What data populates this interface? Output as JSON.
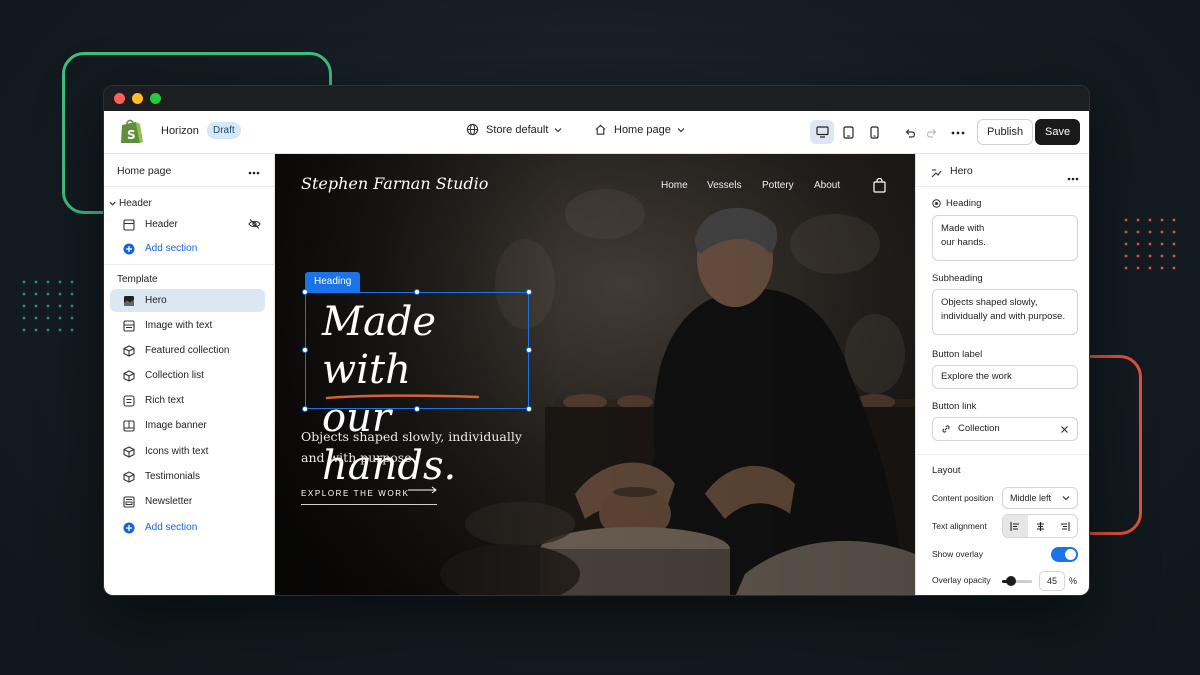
{
  "window": {
    "traffic_lights": [
      "#ff5f57",
      "#febc2e",
      "#28c840"
    ]
  },
  "toolbar": {
    "app_name": "Horizon",
    "badge": "Draft",
    "store": "Store default",
    "page": "Home page",
    "publish_label": "Publish",
    "save_label": "Save"
  },
  "sidebar": {
    "title": "Home page",
    "header_group": "Header",
    "header_item": "Header",
    "add_section_1": "Add section",
    "template_group": "Template",
    "items": [
      {
        "label": "Hero",
        "icon": "hero-icon"
      },
      {
        "label": "Image with text",
        "icon": "image-text-icon"
      },
      {
        "label": "Featured collection",
        "icon": "cube-icon"
      },
      {
        "label": "Collection list",
        "icon": "cube-icon"
      },
      {
        "label": "Rich text",
        "icon": "text-icon"
      },
      {
        "label": "Image banner",
        "icon": "banner-icon"
      },
      {
        "label": "Icons with text",
        "icon": "cube-icon"
      },
      {
        "label": "Testimonials",
        "icon": "cube-icon"
      },
      {
        "label": "Newsletter",
        "icon": "newsletter-icon"
      }
    ],
    "add_section_2": "Add section"
  },
  "preview": {
    "brand": "Stephen Farnan Studio",
    "nav": [
      "Home",
      "Vessels",
      "Pottery",
      "About"
    ],
    "selection_tag": "Heading",
    "heading_line1": "Made with",
    "heading_line2": "our hands.",
    "subheading": "Objects shaped slowly, individually and with purpose.",
    "cta": "EXPLORE THE WORK"
  },
  "panel": {
    "title": "Hero",
    "heading_label": "Heading",
    "heading_line1": "Made with",
    "heading_line2": "our hands.",
    "subheading_label": "Subheading",
    "subheading_value": "Objects shaped slowly, individually and with purpose.",
    "button_label_label": "Button label",
    "button_label_value": "Explore the work",
    "button_link_label": "Button link",
    "button_link_value": "Collection",
    "layout_label": "Layout",
    "content_position_label": "Content position",
    "content_position_value": "Middle left",
    "text_alignment_label": "Text alignment",
    "show_overlay_label": "Show overlay",
    "show_overlay_on": true,
    "overlay_opacity_label": "Overlay opacity",
    "overlay_opacity_value": "45",
    "overlay_opacity_unit": "%"
  },
  "colors": {
    "accent": "#1a73e8",
    "save_bg": "#1a1a1a",
    "selected_row": "#dbe7f3"
  }
}
